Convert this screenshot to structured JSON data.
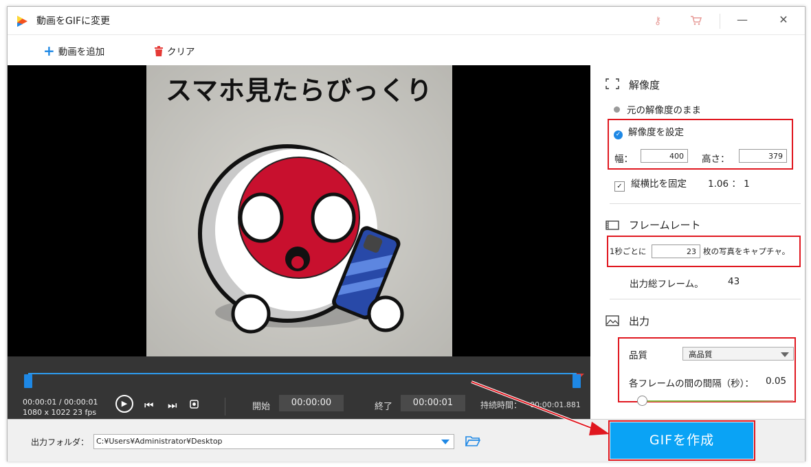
{
  "window": {
    "title": "動画をGIFに変更",
    "key_icon": "key-icon",
    "cart_icon": "cart-icon",
    "minimize": "—",
    "maximize": "☐",
    "close": "✕"
  },
  "toolbar": {
    "add_video": "動画を追加",
    "clear": "クリア"
  },
  "preview": {
    "caption": "スマホ見たらびっくり"
  },
  "controls": {
    "time_current": "00:00:01 / 00:00:01",
    "resolution_fps": "1080 x 1022    23 fps",
    "start_label": "開始",
    "start_value": "00:00:00",
    "end_label": "終了",
    "end_value": "00:00:01",
    "duration_label": "持続時間：",
    "duration_value": "00:00:01.881"
  },
  "panel": {
    "resolution": {
      "title": "解像度",
      "keep_original": "元の解像度のまま",
      "set_resolution": "解像度を設定",
      "width_label": "幅：",
      "width_value": "400",
      "height_label": "高さ：",
      "height_value": "379",
      "keep_ratio": "縦横比を固定",
      "ratio_value": "1.06 ： 1"
    },
    "framerate": {
      "title": "フレームレート",
      "per_second_prefix": "1秒ごとに",
      "per_second_value": "23",
      "per_second_suffix": "枚の写真をキャプチャ。",
      "total_frames_label": "出力総フレーム。",
      "total_frames_value": "43"
    },
    "output": {
      "title": "出力",
      "quality_label": "品質",
      "quality_value": "高品質",
      "interval_label": "各フレームの間の間隔（秒）：",
      "interval_value": "0.05",
      "interval_slider_fraction": 0.02
    }
  },
  "bottom": {
    "output_folder_label": "出力フォルダ：",
    "output_folder_path": "C:¥Users¥Administrator¥Desktop",
    "create_gif": "GIFを作成"
  },
  "colors": {
    "accent": "#0aa3f5",
    "highlight": "#e0171f",
    "flag_red": "#c8102e"
  }
}
